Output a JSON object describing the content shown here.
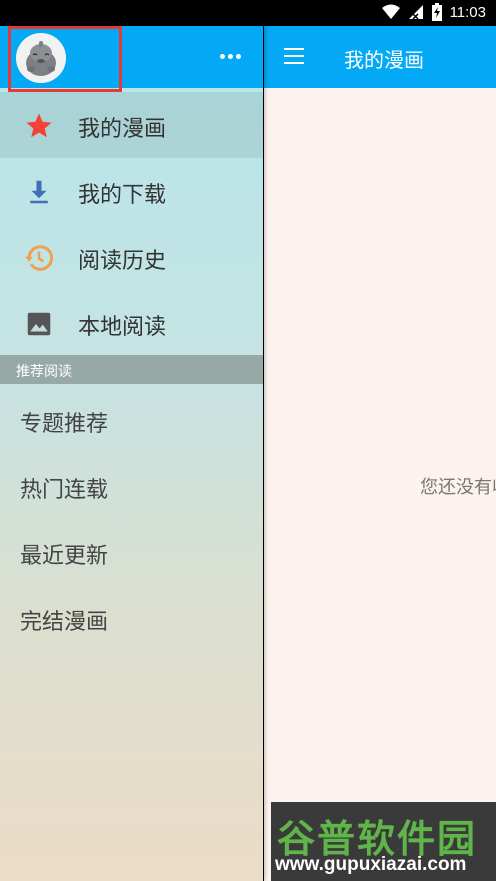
{
  "status_bar": {
    "time": "11:03",
    "icons": [
      "wifi-icon",
      "signal-icon",
      "battery-charging-icon"
    ]
  },
  "drawer": {
    "header": {
      "avatar": "avatar",
      "more_icon": "more-horizontal-icon",
      "color": "#03a9f4"
    },
    "menu": [
      {
        "label": "我的漫画",
        "icon": "star-icon",
        "icon_color": "#f44336",
        "active": true
      },
      {
        "label": "我的下载",
        "icon": "download-icon",
        "icon_color": "#3f6fb6",
        "active": false
      },
      {
        "label": "阅读历史",
        "icon": "history-icon",
        "icon_color": "#f0a050",
        "active": false
      },
      {
        "label": "本地阅读",
        "icon": "image-icon",
        "icon_color": "#555555",
        "active": false
      }
    ],
    "section_title": "推荐阅读",
    "recommend": [
      {
        "label": "专题推荐"
      },
      {
        "label": "热门连载"
      },
      {
        "label": "最近更新"
      },
      {
        "label": "完结漫画"
      }
    ]
  },
  "main": {
    "title": "我的漫画",
    "empty_text": "您还没有收藏漫画"
  },
  "watermark": {
    "line1": "谷普软件园",
    "line2": "www.gupuxiazai.com"
  },
  "colors": {
    "toolbar": "#03a9f4",
    "highlight": "#e53935",
    "background": "#fdf3ee"
  }
}
